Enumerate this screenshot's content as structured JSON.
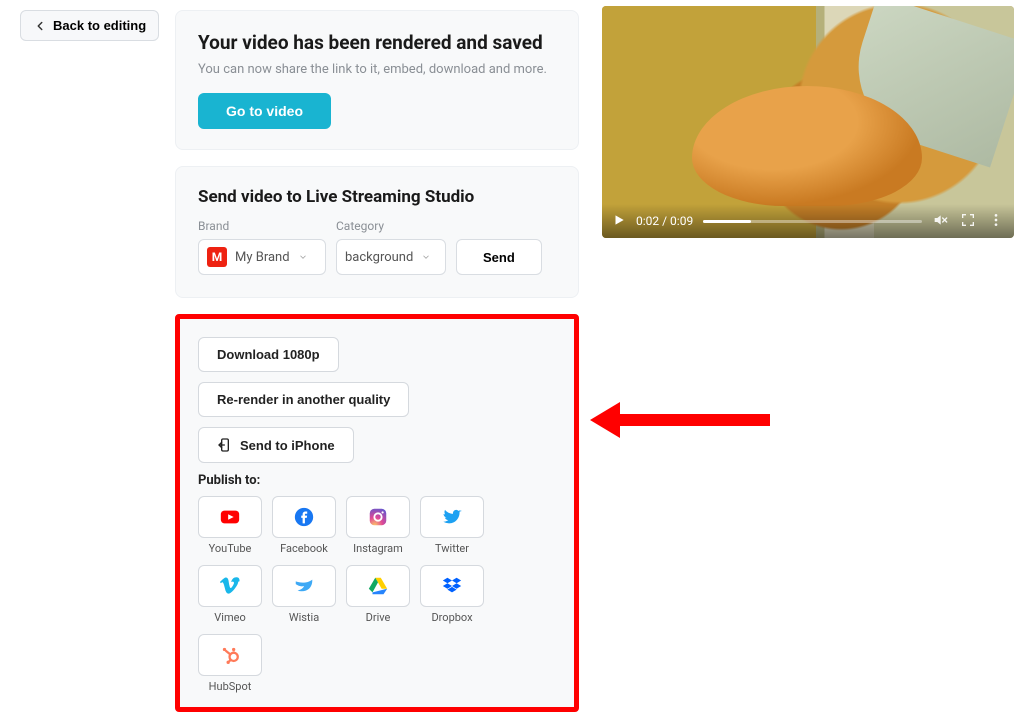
{
  "back": {
    "label": "Back to editing"
  },
  "rendered": {
    "title": "Your video has been rendered and saved",
    "subtitle": "You can now share the link to it, embed, download and more.",
    "cta": "Go to video"
  },
  "live": {
    "title": "Send video to Live Streaming Studio",
    "brand_label": "Brand",
    "brand_value": "My Brand",
    "brand_badge": "M",
    "category_label": "Category",
    "category_value": "background",
    "send": "Send"
  },
  "actions": {
    "download": "Download 1080p",
    "rerender": "Re-render in another quality",
    "send_iphone": "Send to iPhone",
    "publish_label": "Publish to:"
  },
  "publish": [
    {
      "id": "youtube",
      "label": "YouTube"
    },
    {
      "id": "facebook",
      "label": "Facebook"
    },
    {
      "id": "instagram",
      "label": "Instagram"
    },
    {
      "id": "twitter",
      "label": "Twitter"
    },
    {
      "id": "vimeo",
      "label": "Vimeo"
    },
    {
      "id": "wistia",
      "label": "Wistia"
    },
    {
      "id": "drive",
      "label": "Drive"
    },
    {
      "id": "dropbox",
      "label": "Dropbox"
    },
    {
      "id": "hubspot",
      "label": "HubSpot"
    }
  ],
  "player": {
    "current": "0:02",
    "duration": "0:09"
  }
}
